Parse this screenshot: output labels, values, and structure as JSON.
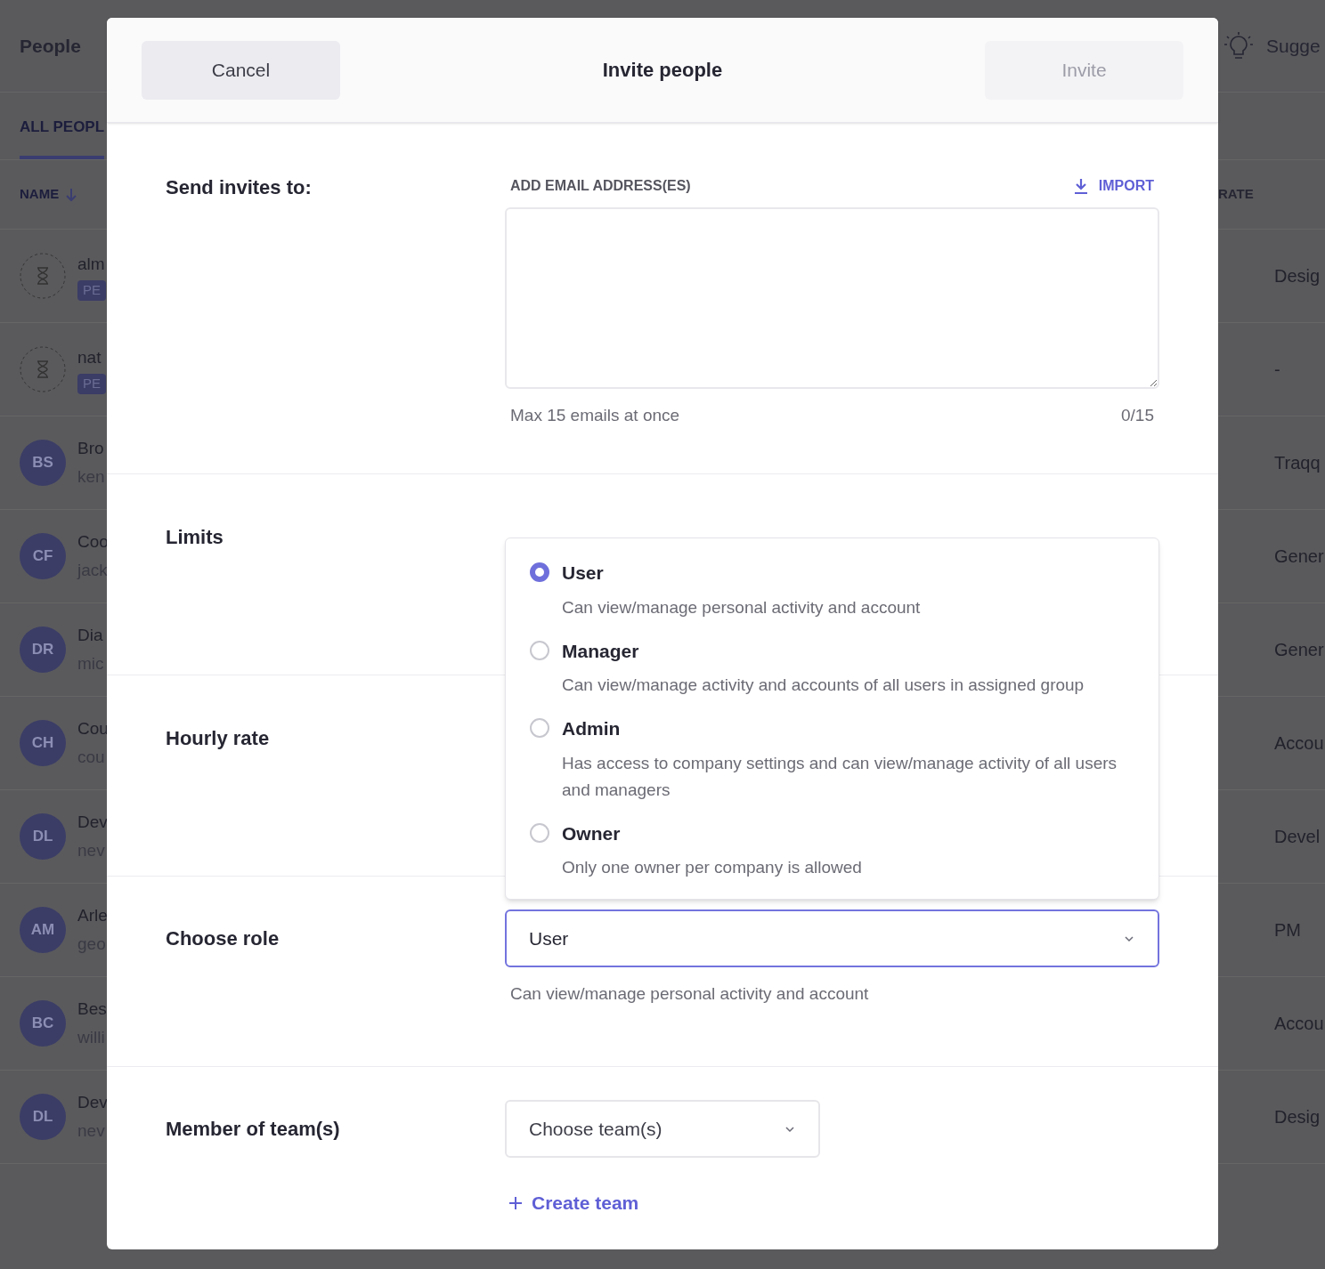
{
  "background": {
    "title": "People",
    "tab": "ALL PEOPL",
    "name_column": "NAME",
    "rate_column": "RATE",
    "suggest": "Sugge",
    "rows": [
      {
        "kind": "pending",
        "name": "alm",
        "badge": "PE",
        "cell": "Desig"
      },
      {
        "kind": "pending",
        "name": "nat",
        "badge": "PE",
        "cell": "-"
      },
      {
        "kind": "member",
        "initials": "BS",
        "name": "Bro",
        "email": "ken",
        "cell": "Traqq"
      },
      {
        "kind": "member",
        "initials": "CF",
        "name": "Coo",
        "email": "jack",
        "cell": "Gener"
      },
      {
        "kind": "member",
        "initials": "DR",
        "name": "Dia",
        "email": "mic",
        "cell": "Gener"
      },
      {
        "kind": "member",
        "initials": "CH",
        "name": "Cou",
        "email": "cou",
        "cell": "Accou"
      },
      {
        "kind": "member",
        "initials": "DL",
        "name": "Dev",
        "email": "nev",
        "cell": "Devel"
      },
      {
        "kind": "member",
        "initials": "AM",
        "name": "Arle",
        "email": "geo",
        "cell": "PM"
      },
      {
        "kind": "member",
        "initials": "BC",
        "name": "Bes",
        "email": "willi",
        "cell": "Accou"
      },
      {
        "kind": "member",
        "initials": "DL",
        "name": "Dev",
        "email": "nev",
        "cell": "Desig"
      }
    ]
  },
  "dialog": {
    "title": "Invite people",
    "cancel": "Cancel",
    "invite": {
      "label": "Invite",
      "disabled": true
    },
    "send": {
      "label": "Send invites to:",
      "field_label": "ADD EMAIL ADDRESS(ES)",
      "import": "IMPORT",
      "hint": "Max 15 emails at once",
      "counter": "0/15"
    },
    "limits": {
      "label": "Limits"
    },
    "hourly": {
      "label": "Hourly rate"
    },
    "role": {
      "label": "Choose role",
      "value": "User",
      "description": "Can view/manage personal activity and account",
      "options": [
        {
          "title": "User",
          "description": "Can view/manage personal activity and account",
          "selected": true
        },
        {
          "title": "Manager",
          "description": "Can view/manage activity and accounts of all users in assigned group",
          "selected": false
        },
        {
          "title": "Admin",
          "description": "Has access to company settings and can view/manage activity of all users and managers",
          "selected": false
        },
        {
          "title": "Owner",
          "description": "Only one owner per company is allowed",
          "selected": false
        }
      ]
    },
    "teams": {
      "label": "Member of team(s)",
      "placeholder": "Choose team(s)",
      "create": "Create team"
    }
  }
}
